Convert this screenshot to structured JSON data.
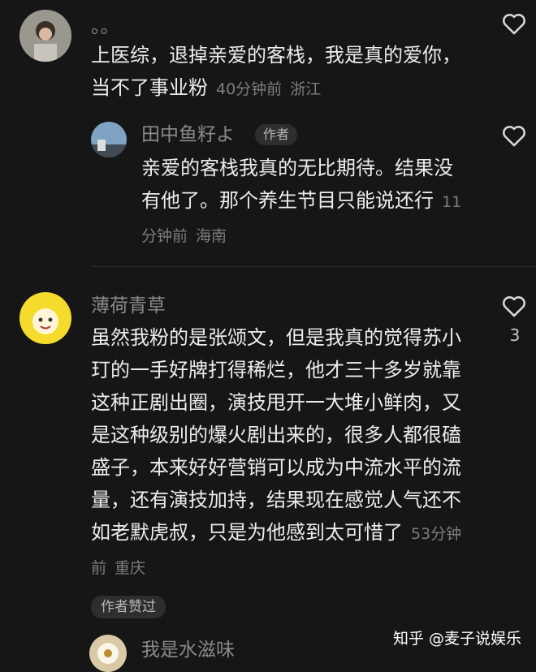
{
  "comments": [
    {
      "user": "。。",
      "text": "上医综，退掉亲爱的客栈，我是真的爱你，当不了事业粉",
      "time": "40分钟前",
      "location": "浙江",
      "reply": {
        "user": "田中鱼籽よ",
        "badge": "作者",
        "text": "亲爱的客栈我真的无比期待。结果没有他了。那个养生节目只能说还行",
        "time": "11分钟前",
        "location": "海南"
      }
    },
    {
      "user": "薄荷青草",
      "text": "虽然我粉的是张颂文，但是我真的觉得苏小玎的一手好牌打得稀烂，他才三十多岁就靠这种正剧出圈，演技甩开一大堆小鲜肉，又是这种级别的爆火剧出来的，很多人都很磕盛子，本来好好营销可以成为中流水平的流量，还有演技加持，结果现在感觉人气还不如老默虎叔，只是为他感到太可惜了",
      "time": "53分钟前",
      "location": "重庆",
      "like_count": "3",
      "author_liked": "作者赞过"
    },
    {
      "user": "我是水滋味"
    }
  ],
  "watermark": "知乎 @麦子说娱乐",
  "colors": {
    "background": "#161616",
    "text": "#ededed",
    "muted": "#7d7d7d"
  }
}
